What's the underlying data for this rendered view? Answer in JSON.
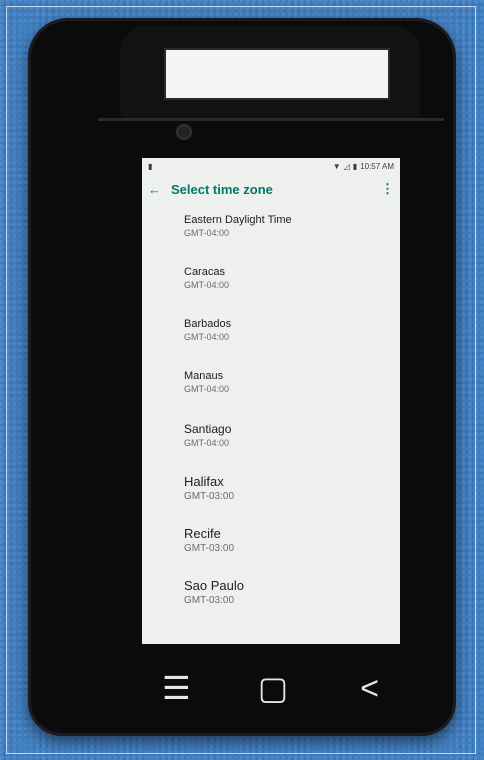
{
  "status": {
    "time": "10:57 AM",
    "left_icon": "sim-icon"
  },
  "appbar": {
    "title": "Select time zone"
  },
  "timezones": [
    {
      "name": "Eastern Daylight Time",
      "offset": "GMT-04:00"
    },
    {
      "name": "Caracas",
      "offset": "GMT-04:00"
    },
    {
      "name": "Barbados",
      "offset": "GMT-04:00"
    },
    {
      "name": "Manaus",
      "offset": "GMT-04:00"
    },
    {
      "name": "Santiago",
      "offset": "GMT-04:00"
    },
    {
      "name": "Halifax",
      "offset": "GMT-03:00"
    },
    {
      "name": "Recife",
      "offset": "GMT-03:00"
    },
    {
      "name": "Sao Paulo",
      "offset": "GMT-03:00"
    }
  ],
  "colors": {
    "accent": "#00796b",
    "background": "#3f7fc4"
  }
}
